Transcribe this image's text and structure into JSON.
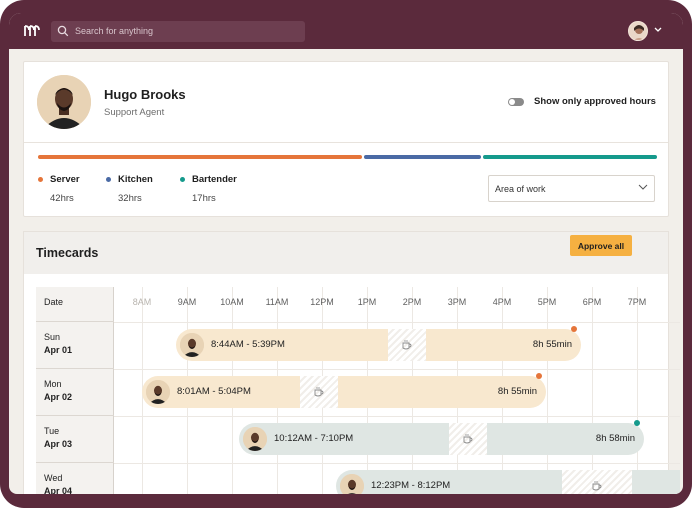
{
  "header": {
    "search_placeholder": "Search for anything"
  },
  "profile": {
    "name": "Hugo Brooks",
    "role": "Support Agent",
    "toggle_label": "Show only approved hours",
    "toggle_on": false
  },
  "work_areas": [
    {
      "name": "Server",
      "hours": "42hrs",
      "color": "#e5753a",
      "share": 0.42
    },
    {
      "name": "Kitchen",
      "hours": "32hrs",
      "color": "#4a6aa5",
      "share": 0.32
    },
    {
      "name": "Bartender",
      "hours": "17hrs",
      "color": "#159a8c",
      "share": 0.17
    }
  ],
  "area_select": {
    "value": "Area of work"
  },
  "timecards": {
    "title": "Timecards",
    "approve_all": "Approve all",
    "date_header": "Date",
    "hours": [
      "8AM",
      "9AM",
      "10AM",
      "11AM",
      "12PM",
      "1PM",
      "2PM",
      "3PM",
      "4PM",
      "5PM",
      "6PM",
      "7PM"
    ],
    "rows": [
      {
        "day": "Sun",
        "date": "Apr 01",
        "range": "8:44AM - 5:39PM",
        "total": "8h 55min",
        "color": "tan",
        "status_color": "#e5753a"
      },
      {
        "day": "Mon",
        "date": "Apr 02",
        "range": "8:01AM - 5:04PM",
        "total": "8h 55min",
        "color": "tan",
        "status_color": "#e5753a"
      },
      {
        "day": "Tue",
        "date": "Apr 03",
        "range": "10:12AM - 7:10PM",
        "total": "8h 58min",
        "color": "teal",
        "status_color": "#159a8c"
      },
      {
        "day": "Wed",
        "date": "Apr 04",
        "range": "12:23PM - 8:12PM",
        "total": "",
        "color": "teal",
        "status_color": ""
      }
    ]
  },
  "colors": {
    "brand": "#5b2a3c",
    "approve": "#f5b041",
    "shift_tan": "#f8e8cf",
    "shift_teal": "#dfe6e3"
  }
}
